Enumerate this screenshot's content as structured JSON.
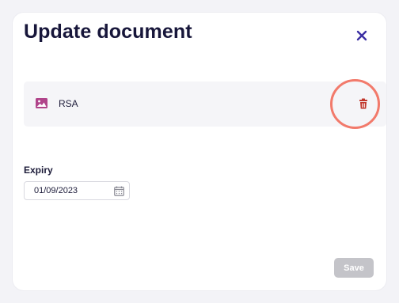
{
  "dialog": {
    "title": "Update document",
    "close_icon": "close-icon"
  },
  "file": {
    "name": "RSA",
    "type_icon": "image-icon",
    "delete_icon": "trash-icon",
    "highlighted": true
  },
  "expiry": {
    "label": "Expiry",
    "value": "01/09/2023",
    "icon": "calendar-icon"
  },
  "actions": {
    "save_label": "Save",
    "save_enabled": false
  },
  "colors": {
    "title": "#17163a",
    "close": "#3b2fa3",
    "file_icon": "#b0448a",
    "delete_icon": "#c0362b",
    "highlight_ring": "#f27a6b",
    "save_disabled_bg": "#c4c4c9"
  }
}
